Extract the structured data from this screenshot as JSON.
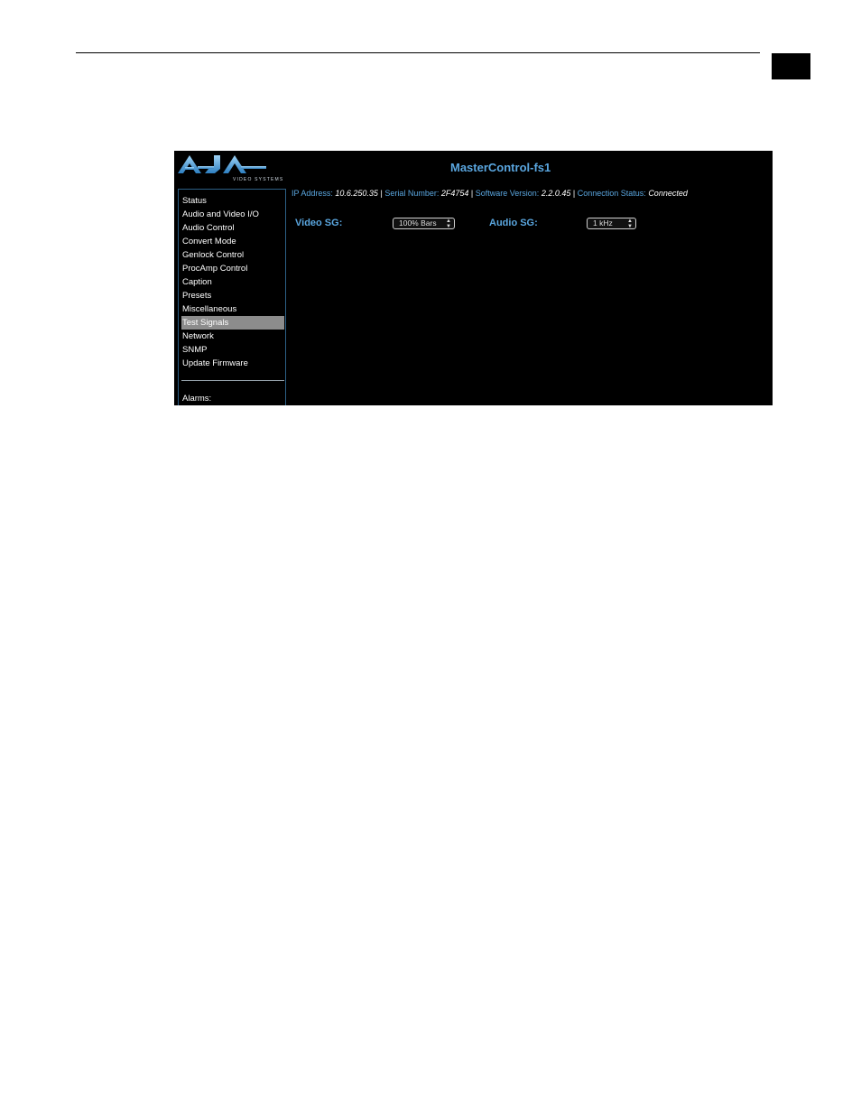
{
  "app": {
    "logo_text": "AJA",
    "logo_subtext": "VIDEO SYSTEMS",
    "title": "MasterControl-fs1"
  },
  "sidebar": {
    "items": [
      {
        "label": "Status"
      },
      {
        "label": "Audio and Video I/O"
      },
      {
        "label": "Audio Control"
      },
      {
        "label": "Convert Mode"
      },
      {
        "label": "Genlock Control"
      },
      {
        "label": "ProcAmp Control"
      },
      {
        "label": "Caption"
      },
      {
        "label": "Presets"
      },
      {
        "label": "Miscellaneous"
      },
      {
        "label": "Test Signals",
        "active": true
      },
      {
        "label": "Network"
      },
      {
        "label": "SNMP"
      },
      {
        "label": "Update Firmware"
      }
    ],
    "alarms_label": "Alarms:"
  },
  "status": {
    "ip_label": "IP Address:",
    "ip_value": "10.6.250.35",
    "serial_label": "Serial Number:",
    "serial_value": "2F4754",
    "software_label": "Software Version:",
    "software_value": "2.2.0.45",
    "connection_label": "Connection Status:",
    "connection_value": "Connected",
    "separator": "|"
  },
  "test_signals": {
    "video_label": "Video SG:",
    "video_value": "100% Bars",
    "audio_label": "Audio SG:",
    "audio_value": "1 kHz"
  },
  "colors": {
    "accent": "#5aa6df",
    "background": "#000000",
    "active_item": "#8c8c8c"
  }
}
